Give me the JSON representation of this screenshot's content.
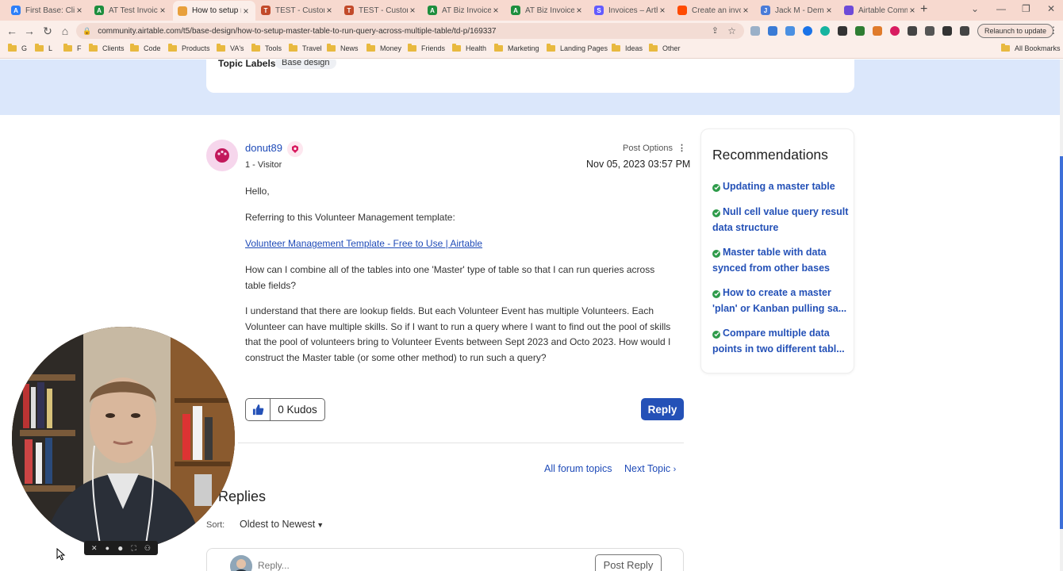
{
  "browser": {
    "tabs": [
      {
        "title": "First Base: Clie",
        "icon": "airtable-icon",
        "color": "#2d7ff9",
        "letter": "A"
      },
      {
        "title": "AT Test Invoice",
        "icon": "spreadsheet-icon",
        "color": "#1e8e3e",
        "letter": "A"
      },
      {
        "title": "How to setup m",
        "icon": "airtable-community-icon",
        "color": "#e8a03c",
        "letter": "",
        "active": true
      },
      {
        "title": "TEST - Custom",
        "icon": "document-icon",
        "color": "#c24a2a",
        "letter": "T"
      },
      {
        "title": "TEST - Custom",
        "icon": "document-icon",
        "color": "#c24a2a",
        "letter": "T"
      },
      {
        "title": "AT Biz Invoice",
        "icon": "spreadsheet-icon",
        "color": "#1e8e3e",
        "letter": "A"
      },
      {
        "title": "AT Biz Invoice",
        "icon": "spreadsheet-icon",
        "color": "#1e8e3e",
        "letter": "A"
      },
      {
        "title": "Invoices – Arth",
        "icon": "stripe-icon",
        "color": "#635bff",
        "letter": "S"
      },
      {
        "title": "Create an invo",
        "icon": "zapier-icon",
        "color": "#ff4a00",
        "letter": ""
      },
      {
        "title": "Jack M - Demo",
        "icon": "doc-icon",
        "color": "#4a7bd8",
        "letter": "J"
      },
      {
        "title": "Airtable Comm",
        "icon": "gear-icon",
        "color": "#6d4ad8",
        "letter": ""
      }
    ],
    "url": "community.airtable.com/t5/base-design/how-to-setup-master-table-to-run-query-across-multiple-table/td-p/169337",
    "relaunch_label": "Relaunch to update",
    "bookmarks": [
      "G",
      "L",
      "F",
      "Clients",
      "Code",
      "Products",
      "VA's",
      "Tools",
      "Travel",
      "News",
      "Money",
      "Friends",
      "Health",
      "Marketing",
      "Landing Pages",
      "Ideas",
      "Other"
    ],
    "all_bookmarks": "All Bookmarks"
  },
  "topic": {
    "labels_caption": "Topic Labels:",
    "label": "Base design"
  },
  "post": {
    "author": "donut89",
    "rank": "1 - Visitor",
    "options_label": "Post Options",
    "date": "Nov 05, 2023 03:57 PM",
    "greeting": "Hello,",
    "intro": "Referring to this Volunteer Management template:",
    "link_text": "Volunteer Management Template - Free to Use | Airtable",
    "question": "How can I combine all of the tables into one 'Master' type of table so that I can run queries across table fields?",
    "details": "I understand that there are lookup fields.  But each Volunteer Event has multiple Volunteers.  Each Volunteer can have multiple skills.  So if I want to run a query where I want to find out the pool of skills that the pool of volunteers bring to Volunteer Events between Sept 2023 and Octo 2023.  How would I construct the Master table (or some other method) to run such a query?",
    "kudos_label": "0 Kudos",
    "reply_label": "Reply"
  },
  "navigation": {
    "all_topics": "All forum topics",
    "next_topic": "Next Topic"
  },
  "replies": {
    "title": "Replies",
    "sort_label": "Sort:",
    "sort_value": "Oldest to Newest",
    "reply_placeholder": "Reply...",
    "post_reply_label": "Post Reply"
  },
  "recommendations": {
    "title": "Recommendations",
    "items": [
      "Updating a master table",
      "Null cell value query result data structure",
      "Master table with data synced from other bases",
      "How to create a master 'plan' or Kanban pulling sa...",
      "Compare multiple data points in two different tabl..."
    ]
  },
  "colors": {
    "link": "#1f4bb8",
    "button": "#2451b7",
    "hero": "#dbe7fb",
    "check": "#2e9b4a",
    "tabbar": "#f7d9cf"
  }
}
